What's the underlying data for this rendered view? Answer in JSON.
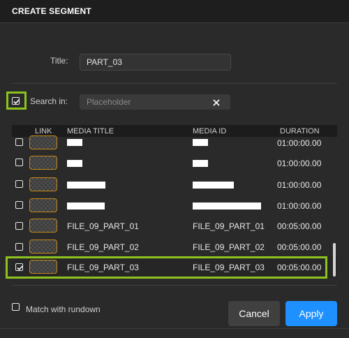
{
  "dialog": {
    "title": "CREATE SEGMENT"
  },
  "form": {
    "title_label": "Title:",
    "title_value": "PART_03",
    "search_label": "Search in:",
    "search_placeholder": "Placeholder",
    "search_checked": true
  },
  "table": {
    "columns": [
      "LINK",
      "MEDIA TITLE",
      "MEDIA ID",
      "DURATION"
    ],
    "rows": [
      {
        "checked": false,
        "title": "",
        "media_id": "",
        "duration": "01:00:00.00"
      },
      {
        "checked": false,
        "title": "",
        "media_id": "",
        "duration": "01:00:00.00"
      },
      {
        "checked": false,
        "title": "",
        "media_id": "",
        "duration": "01:00:00.00"
      },
      {
        "checked": false,
        "title": "",
        "media_id": "",
        "duration": "01:00:00.00"
      },
      {
        "checked": false,
        "title": "FILE_09_PART_01",
        "media_id": "FILE_09_PART_01",
        "duration": "00:05:00.00"
      },
      {
        "checked": false,
        "title": "FILE_09_PART_02",
        "media_id": "FILE_09_PART_02",
        "duration": "00:05:00.00"
      },
      {
        "checked": true,
        "title": "FILE_09_PART_03",
        "media_id": "FILE_09_PART_03",
        "duration": "00:05:00.00"
      }
    ]
  },
  "footer": {
    "match_label": "Match with rundown",
    "cancel_label": "Cancel",
    "apply_label": "Apply"
  },
  "colors": {
    "highlight": "#8dc21f",
    "apply": "#1e90ff",
    "thumb_border": "#c58a1a"
  }
}
